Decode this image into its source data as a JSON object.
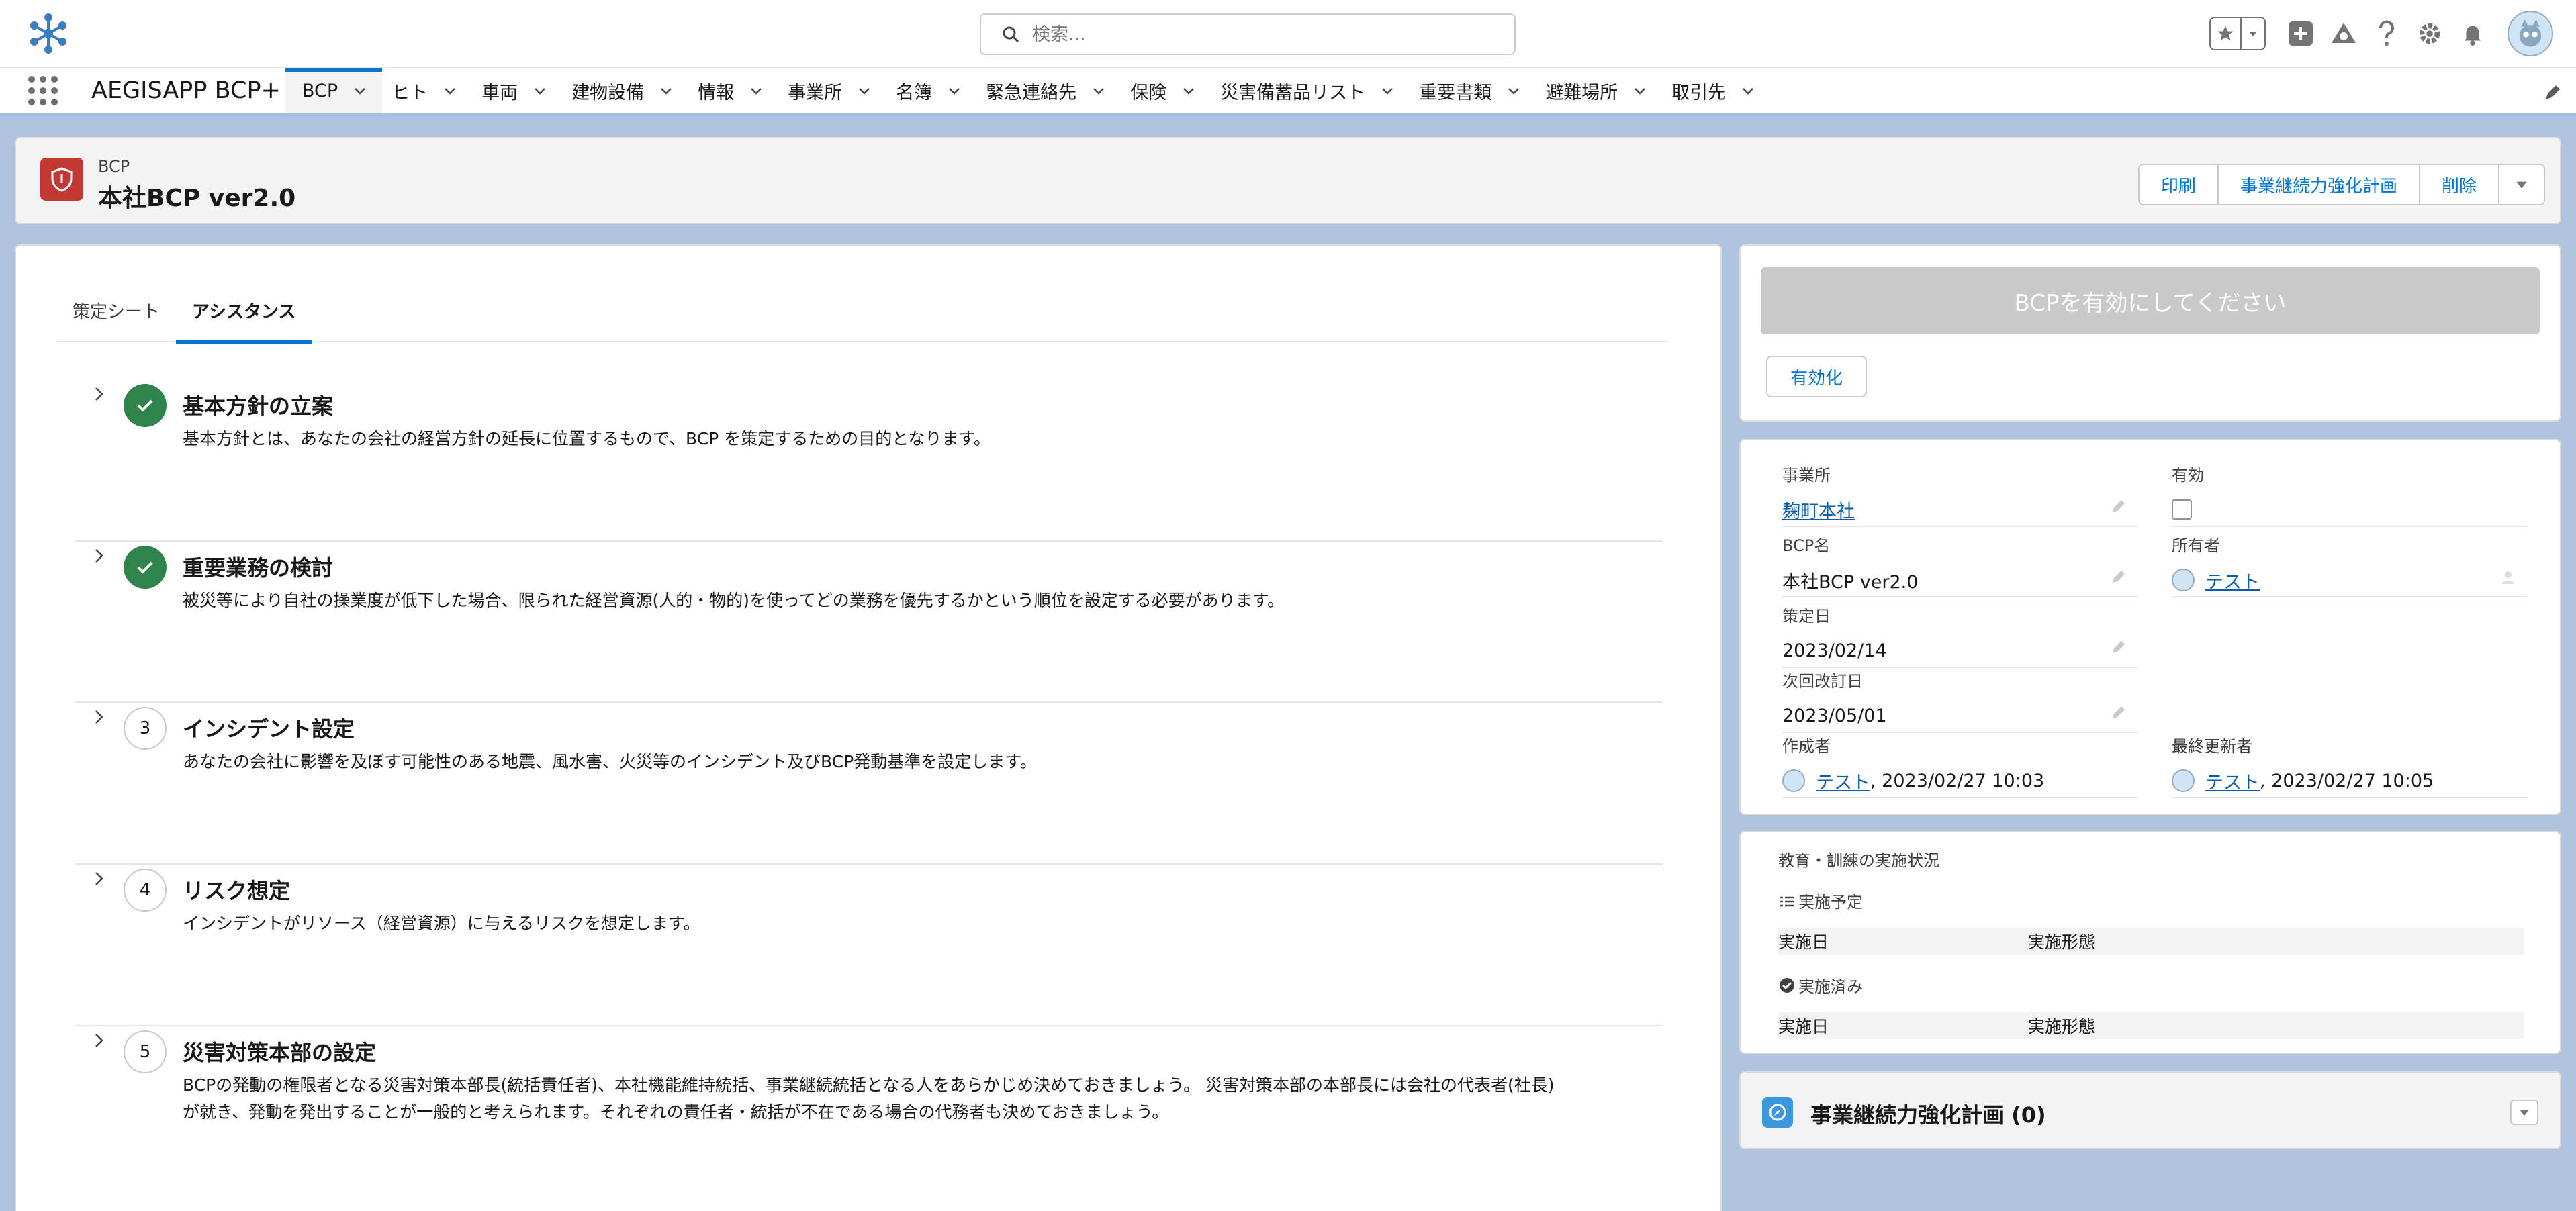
{
  "header": {
    "search_placeholder": "検索...",
    "icons": [
      "favorites-star-icon",
      "favorites-menu-icon",
      "add-icon",
      "trailhead-icon",
      "help-icon",
      "setup-gear-icon",
      "notifications-bell-icon",
      "user-avatar"
    ]
  },
  "nav": {
    "app_name": "AEGISAPP BCP+",
    "items": [
      {
        "label": "BCP",
        "active": true
      },
      {
        "label": "ヒト"
      },
      {
        "label": "車両"
      },
      {
        "label": "建物設備"
      },
      {
        "label": "情報"
      },
      {
        "label": "事業所"
      },
      {
        "label": "名簿"
      },
      {
        "label": "緊急連絡先"
      },
      {
        "label": "保険"
      },
      {
        "label": "災害備蓄品リスト"
      },
      {
        "label": "重要書類"
      },
      {
        "label": "避難場所"
      },
      {
        "label": "取引先"
      }
    ]
  },
  "record": {
    "object_label": "BCP",
    "title": "本社BCP ver2.0",
    "actions": [
      "印刷",
      "事業継続力強化計画",
      "削除"
    ]
  },
  "tabs": [
    "策定シート",
    "アシスタンス"
  ],
  "active_tab": "アシスタンス",
  "steps": [
    {
      "status": "done",
      "number": "",
      "title": "基本方針の立案",
      "desc": "基本方針とは、あなたの会社の経営方針の延長に位置するもので、BCP を策定するための目的となります。"
    },
    {
      "status": "done",
      "number": "",
      "title": "重要業務の検討",
      "desc": "被災等により自社の操業度が低下した場合、限られた経営資源(人的・物的)を使ってどの業務を優先するかという順位を設定する必要があります。"
    },
    {
      "status": "todo",
      "number": "3",
      "title": "インシデント設定",
      "desc": "あなたの会社に影響を及ぼす可能性のある地震、風水害、火災等のインシデント及びBCP発動基準を設定します。"
    },
    {
      "status": "todo",
      "number": "4",
      "title": "リスク想定",
      "desc": "インシデントがリソース（経営資源）に与えるリスクを想定します。"
    },
    {
      "status": "todo",
      "number": "5",
      "title": "災害対策本部の設定",
      "desc_lines": [
        "BCPの発動の権限者となる災害対策本部長(統括責任者)、本社機能維持統括、事業継続統括となる人をあらかじめ決めておきましょう。 災害対策本部の本部長には会社の代表者(社長)",
        "が就き、発動を発出することが一般的と考えられます。それぞれの責任者・統括が不在である場合の代務者も決めておきましょう。"
      ]
    }
  ],
  "activation": {
    "banner": "BCPを有効にしてください",
    "button": "有効化"
  },
  "details": {
    "office_label": "事業所",
    "office_value": "麹町本社",
    "active_label": "有効",
    "active_checked": false,
    "name_label": "BCP名",
    "name_value": "本社BCP ver2.0",
    "owner_label": "所有者",
    "owner_value": "テスト",
    "formulated_label": "策定日",
    "formulated_value": "2023/02/14",
    "next_revision_label": "次回改訂日",
    "next_revision_value": "2023/05/01",
    "created_by_label": "作成者",
    "created_by_user": "テスト",
    "created_by_date": ", 2023/02/27 10:03",
    "modified_by_label": "最終更新者",
    "modified_by_user": "テスト",
    "modified_by_date": ", 2023/02/27 10:05"
  },
  "training": {
    "title": "教育・訓練の実施状況",
    "scheduled_label": "実施予定",
    "completed_label": "実施済み",
    "col_date": "実施日",
    "col_form": "実施形態"
  },
  "plan_related": {
    "title": "事業継続力強化計画 (0)"
  },
  "colors": {
    "brand_blue": "#0176d3",
    "done_green": "#2e844a",
    "record_icon": "#c23934",
    "page_bg": "#b0c4df"
  }
}
